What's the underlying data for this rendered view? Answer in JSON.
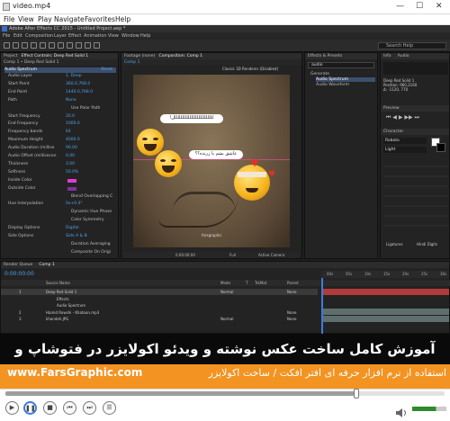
{
  "window": {
    "title": "video.mp4",
    "minimize": "—",
    "maximize": "☐",
    "close": "✕"
  },
  "menu": [
    "File",
    "View",
    "Play",
    "Navigate",
    "Favorites",
    "Help"
  ],
  "ae": {
    "title": "Adobe After Effects CC 2015 - Untitled Project.aep *",
    "menu": [
      "File",
      "Edit",
      "Composition",
      "Layer",
      "Effect",
      "Animation",
      "View",
      "Window",
      "Help"
    ],
    "search_placeholder": "Search Help",
    "left_tabs": [
      "Project",
      "Effect Controls: Deep Red Solid 1"
    ],
    "left_header": "Comp 1 • Deep Red Solid 1",
    "effect_name": "Audio Spectrum",
    "effect_reset": "Reset",
    "props": [
      {
        "label": "Audio Layer",
        "value": "1. Deep"
      },
      {
        "label": "Start Point",
        "value": "360.0,768.0"
      },
      {
        "label": "End Point",
        "value": "1440.0,768.0"
      },
      {
        "label": "Path",
        "value": "None"
      },
      {
        "label": "",
        "value": "Use Polar Path"
      },
      {
        "label": "Start Frequency",
        "value": "20.0"
      },
      {
        "label": "End Frequency",
        "value": "1000.0"
      },
      {
        "label": "Frequency bands",
        "value": "64"
      },
      {
        "label": "Maximum Height",
        "value": "4000.0"
      },
      {
        "label": "Audio Duration (millise",
        "value": "90.00"
      },
      {
        "label": "Audio Offset (millisecon",
        "value": "0.00"
      },
      {
        "label": "Thickness",
        "value": "3.00"
      },
      {
        "label": "Softness",
        "value": "50.0%"
      },
      {
        "label": "Inside Color",
        "value": ""
      },
      {
        "label": "Outside Color",
        "value": ""
      },
      {
        "label": "",
        "value": "Blend Overlapping C"
      },
      {
        "label": "Hue Interpolation",
        "value": "0x+0.0°"
      },
      {
        "label": "",
        "value": "Dynamic Hue Phase"
      },
      {
        "label": "",
        "value": "Color Symmetry"
      },
      {
        "label": "Display Options",
        "value": "Digital"
      },
      {
        "label": "Side Options",
        "value": "Side A & B"
      },
      {
        "label": "",
        "value": "Duration Averaging"
      },
      {
        "label": "",
        "value": "Composite On Origi"
      }
    ],
    "comp_tabs": [
      "Footage (none)",
      "Composition: Comp 1"
    ],
    "comp_sub": "Comp 1",
    "canvas_note": "Classic 3D Renderer (Disabled)",
    "bubble1": "!کلللللللللللللللللللللللللل",
    "bubble2": "عاشق بشم یا زرنده؟؟",
    "watermark": "farsgraphic",
    "zoom": "Full",
    "camera": "Active Camera",
    "comp_time": "0:00:00:00",
    "effects_tab": "Effects & Presets",
    "effects_search": "audio",
    "effects_tree": [
      "Generate",
      "Audio Spectrum",
      "Audio Waveform"
    ],
    "right_tabs": [
      "Info",
      "Audio"
    ],
    "right_info": [
      "Deep Red Solid 1",
      "Position: 960,2160",
      "Δ: -1120, 770"
    ],
    "preview_tab": "Preview",
    "character_tab": "Character",
    "font": "Roboto",
    "font_style": "Light",
    "right_checks": [
      "Ligatures",
      "Hindi Digits"
    ],
    "tl_tabs": [
      "Render Queue",
      "Comp 1"
    ],
    "tl_time": "0:00:00:00",
    "tl_header": [
      "Source Name",
      "Mode",
      "T",
      "TrkMat",
      "Parent"
    ],
    "layers": [
      {
        "num": "1",
        "name": "Deep Red Solid 1",
        "mode": "Normal",
        "parent": "None"
      },
      {
        "num": "",
        "name": "Effects",
        "mode": "",
        "parent": ""
      },
      {
        "num": "",
        "name": "Audio Spectrum",
        "mode": "",
        "parent": ""
      },
      {
        "num": "2",
        "name": "Hamid Rowshi - Khatoon.mp3",
        "mode": "",
        "parent": "None"
      },
      {
        "num": "3",
        "name": "khandeh.JPG",
        "mode": "Normal",
        "parent": "None"
      }
    ],
    "ruler": [
      "00s",
      "05s",
      "10s",
      "15s",
      "20s",
      "25s",
      "30s"
    ]
  },
  "banner": {
    "title": "آموزش کامل ساخت عکس نوشته و ویدئو اکولایزر در فتوشاپ و افترافکت",
    "url": "www.FarsGraphic.com",
    "subtitle": "استفاده از نرم افزار حرفه ای افتر افکت / ساخت اکولایزر"
  },
  "player": {
    "progress": 0.8,
    "volume": 0.7
  }
}
